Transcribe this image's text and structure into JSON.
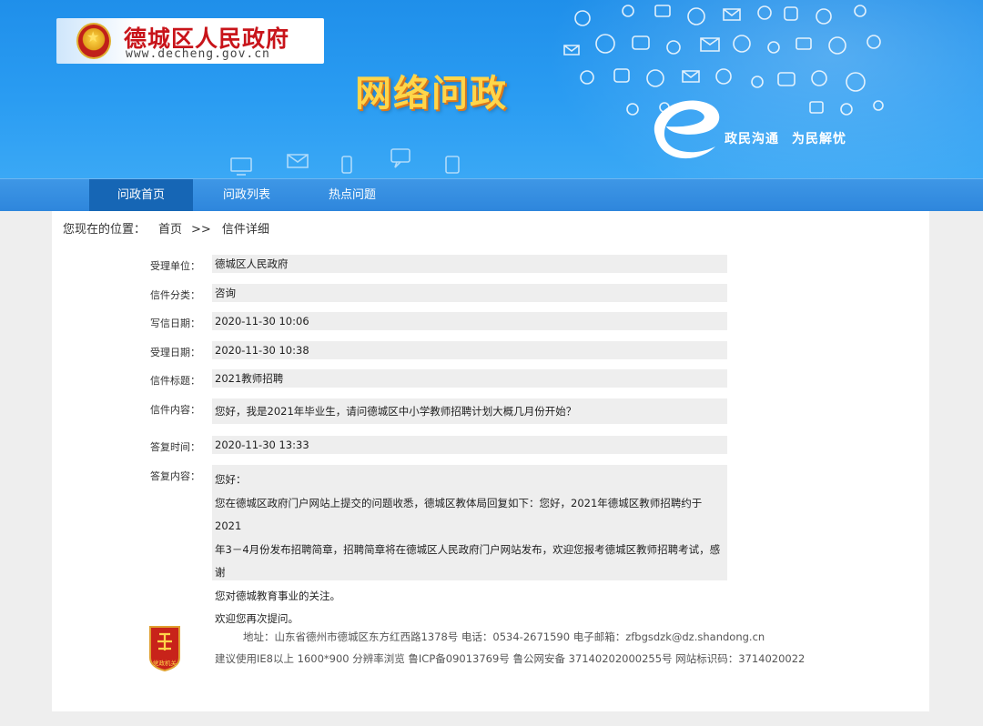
{
  "header": {
    "site_title": "德城区人民政府",
    "site_url": "www.decheng.gov.cn",
    "section_title": "网络问政",
    "slogan_1": "政民沟通",
    "slogan_2": "为民解忧"
  },
  "nav": {
    "items": [
      {
        "label": "问政首页"
      },
      {
        "label": "问政列表"
      },
      {
        "label": "热点问题"
      }
    ]
  },
  "breadcrumb": {
    "prefix": "您现在的位置：",
    "home": "首页",
    "separator": ">>",
    "current": "信件详细"
  },
  "letter": {
    "fields": [
      {
        "label": "受理单位：",
        "value": "德城区人民政府"
      },
      {
        "label": "信件分类：",
        "value": "咨询"
      },
      {
        "label": "写信日期：",
        "value": "2020-11-30 10:06"
      },
      {
        "label": "受理日期：",
        "value": "2020-11-30 10:38"
      },
      {
        "label": "信件标题：",
        "value": "2021教师招聘"
      },
      {
        "label": "信件内容：",
        "value": "您好，我是2021年毕业生，请问德城区中小学教师招聘计划大概几月份开始？"
      },
      {
        "label": "答复时间：",
        "value": "2020-11-30 13:33"
      }
    ],
    "reply": {
      "label": "答复内容：",
      "lines": [
        "您好：",
        "您在德城区政府门户网站上提交的问题收悉，德城区教体局回复如下：您好，2021年德城区教师招聘约于2021",
        "年3－4月份发布招聘简章，招聘简章将在德城区人民政府门户网站发布，欢迎您报考德城区教师招聘考试，感谢",
        "您对德城教育事业的关注。",
        "欢迎您再次提问。"
      ]
    }
  },
  "footer": {
    "badge_text": "党政机关",
    "line_1": "地址：山东省德州市德城区东方红西路1378号 电话：0534-2671590 电子邮箱：zfbgsdzk@dz.shandong.cn",
    "line_2": "建议使用IE8以上 1600*900 分辨率浏览 鲁ICP备09013769号 鲁公网安备 37140202000255号 网站标识码：3714020022"
  },
  "colors": {
    "banner_blue": "#2a9cf2",
    "nav_blue": "#2e86dc",
    "nav_active": "#1666b5",
    "title_red": "#c8141a",
    "title_gold": "#ffd64a",
    "field_bg": "#eeeeee"
  }
}
